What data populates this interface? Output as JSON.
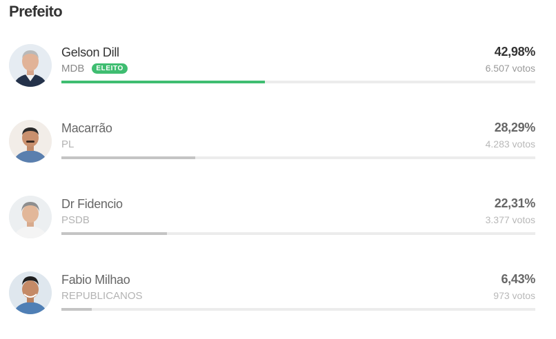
{
  "section_title": "Prefeito",
  "elected_badge": "ELEITO",
  "colors": {
    "winner_bar": "#3fbd71",
    "bar": "#c4c4c4",
    "track": "#ececec"
  },
  "candidates": [
    {
      "name": "Gelson Dill",
      "party": "MDB",
      "percent_label": "42,98%",
      "percent": 42.98,
      "votes": "6.507 votos",
      "elected": true,
      "photo": "candidate-photo"
    },
    {
      "name": "Macarrão",
      "party": "PL",
      "percent_label": "28,29%",
      "percent": 28.29,
      "votes": "4.283 votos",
      "elected": false,
      "photo": "candidate-photo"
    },
    {
      "name": "Dr Fidencio",
      "party": "PSDB",
      "percent_label": "22,31%",
      "percent": 22.31,
      "votes": "3.377 votos",
      "elected": false,
      "photo": "candidate-photo"
    },
    {
      "name": "Fabio Milhao",
      "party": "REPUBLICANOS",
      "percent_label": "6,43%",
      "percent": 6.43,
      "votes": "973 votos",
      "elected": false,
      "photo": "candidate-photo"
    }
  ]
}
